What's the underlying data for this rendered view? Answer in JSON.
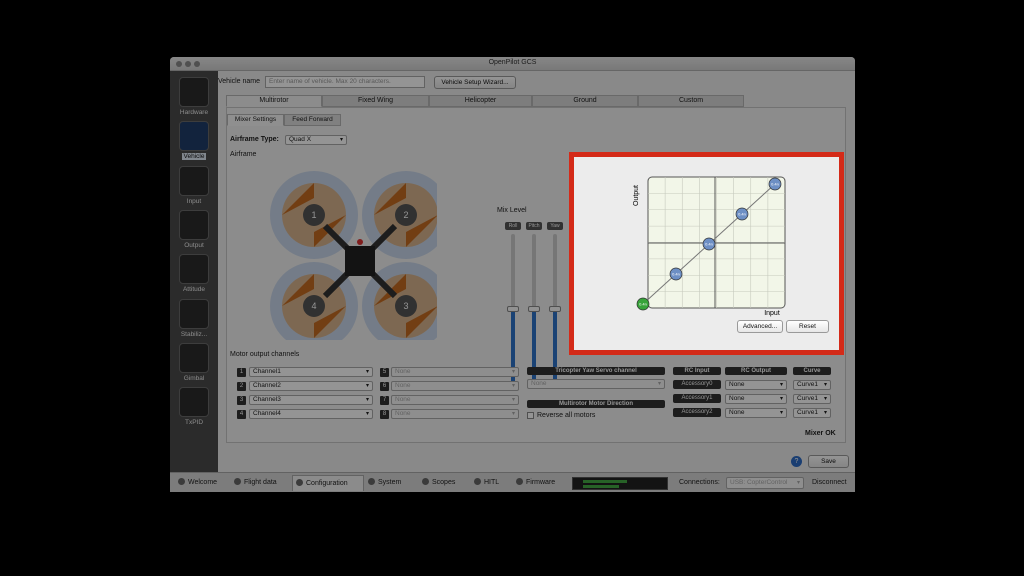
{
  "window": {
    "title": "OpenPilot GCS"
  },
  "sidebar": {
    "items": [
      {
        "label": "Hardware"
      },
      {
        "label": "Vehicle"
      },
      {
        "label": "Input"
      },
      {
        "label": "Output"
      },
      {
        "label": "Attitude"
      },
      {
        "label": "Stabiliz..."
      },
      {
        "label": "Gimbal"
      },
      {
        "label": "TxPID"
      }
    ]
  },
  "vehicle": {
    "name_label": "Vehicle name",
    "name_placeholder": "Enter name of vehicle. Max 20 characters.",
    "wizard_button": "Vehicle Setup Wizard..."
  },
  "type_tabs": [
    "Multirotor",
    "Fixed Wing",
    "Helicopter",
    "Ground",
    "Custom"
  ],
  "sub_tabs": [
    "Mixer Settings",
    "Feed Forward"
  ],
  "airframe": {
    "type_label": "Airframe Type:",
    "type_value": "Quad X",
    "section_label": "Airframe",
    "motors": [
      "1",
      "2",
      "4",
      "3"
    ]
  },
  "mix_level": {
    "label": "Mix Level",
    "sliders": [
      {
        "name": "Roll",
        "value": "50",
        "level": 0.5
      },
      {
        "name": "Pitch",
        "value": "50",
        "level": 0.5
      },
      {
        "name": "Yaw",
        "value": "50",
        "level": 0.5
      }
    ]
  },
  "motor_outputs": {
    "label": "Motor output channels",
    "left": [
      {
        "num": "1",
        "value": "Channel1"
      },
      {
        "num": "2",
        "value": "Channel2"
      },
      {
        "num": "3",
        "value": "Channel3"
      },
      {
        "num": "4",
        "value": "Channel4"
      }
    ],
    "right": [
      {
        "num": "5",
        "value": "None"
      },
      {
        "num": "6",
        "value": "None"
      },
      {
        "num": "7",
        "value": "None"
      },
      {
        "num": "8",
        "value": "None"
      }
    ]
  },
  "tricopter": {
    "header": "Tricopter Yaw Servo channel",
    "value": "None"
  },
  "motor_direction": {
    "header": "Multirotor Motor Direction",
    "checkbox_label": "Reverse all motors"
  },
  "rc": {
    "headers": [
      "RC Input",
      "RC Output",
      "Curve"
    ],
    "rows": [
      {
        "input": "Accessory0",
        "output": "None",
        "curve": "Curve1"
      },
      {
        "input": "Accessory1",
        "output": "None",
        "curve": "Curve1"
      },
      {
        "input": "Accessory2",
        "output": "None",
        "curve": "Curve1"
      }
    ]
  },
  "status": {
    "mixer_ok": "Mixer OK",
    "save_button": "Save",
    "help_icon": "?"
  },
  "bottom_tabs": [
    "Welcome",
    "Flight data",
    "Configuration",
    "System",
    "Scopes",
    "HITL",
    "Firmware"
  ],
  "bottom_bar": {
    "connections_label": "Connections:",
    "connection_value": "USB: CopterControl",
    "disconnect": "Disconnect"
  },
  "curve": {
    "ylabel": "Output",
    "xlabel": "Input",
    "point_label": "0.4n",
    "advanced_button": "Advanced...",
    "reset_button": "Reset",
    "colors": {
      "point": "#6d8fc4",
      "origin_point": "#37a33a",
      "grid_bg": "#f2f6e8"
    }
  }
}
